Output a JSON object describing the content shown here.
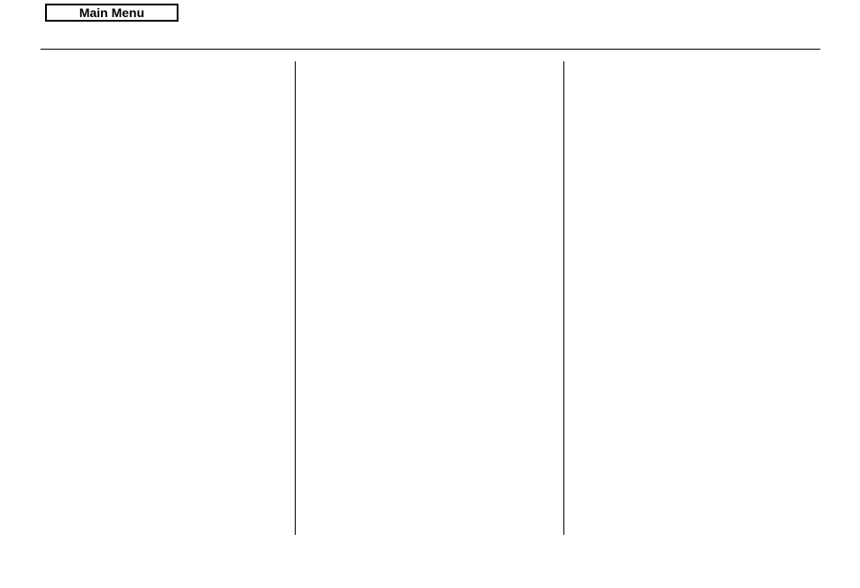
{
  "header": {
    "main_menu_label": "Main Menu"
  }
}
